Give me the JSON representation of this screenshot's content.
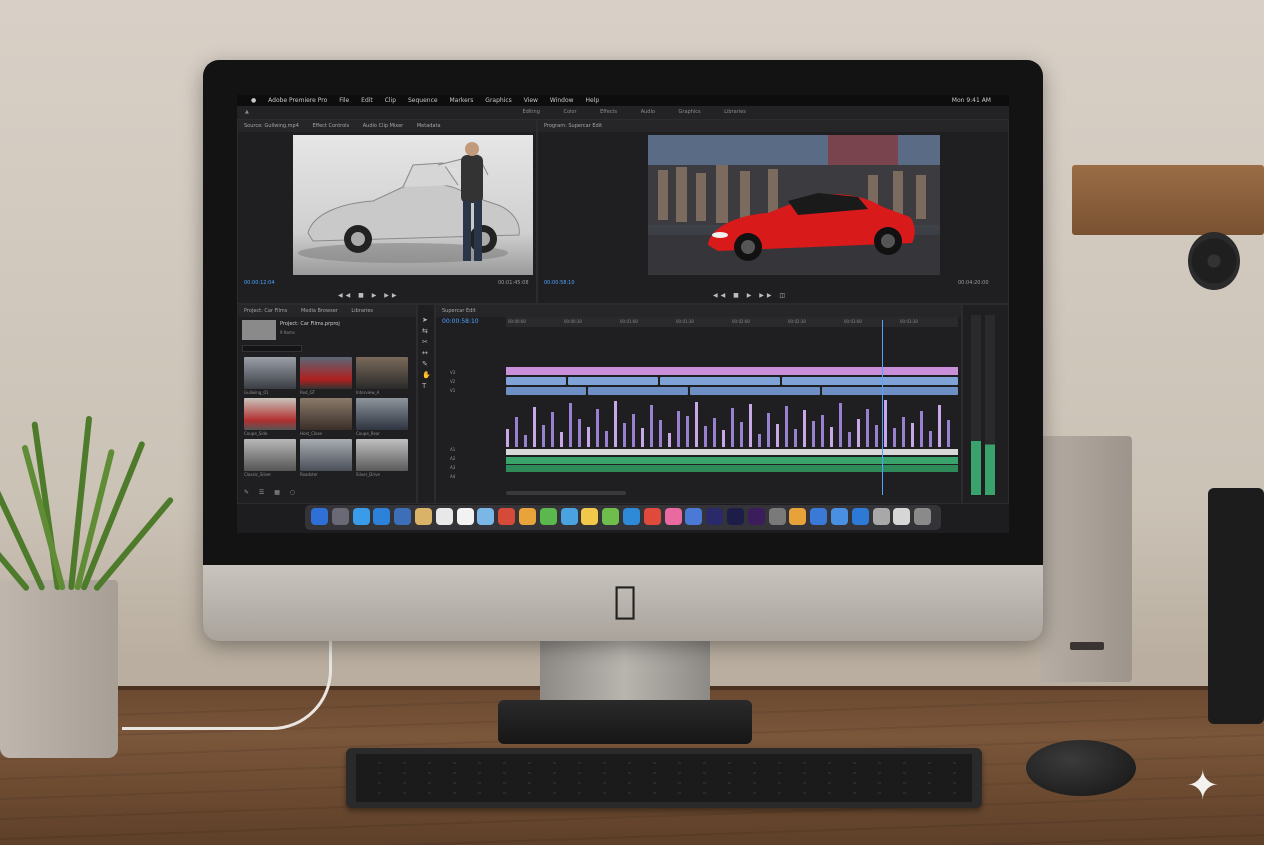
{
  "scene": {
    "description_hidden": "",
    "screen": {
      "menubar": {
        "app_name": "Adobe Premiere Pro",
        "items": [
          "File",
          "Edit",
          "Clip",
          "Sequence",
          "Markers",
          "Graphics",
          "View",
          "Window",
          "Help"
        ],
        "clock": "Mon 9:41 AM"
      },
      "workspaces": [
        "Editing",
        "Color",
        "Effects",
        "Audio",
        "Graphics",
        "Libraries"
      ],
      "source_panel": {
        "tabs": [
          "Source: Gullwing.mp4",
          "Effect Controls",
          "Audio Clip Mixer",
          "Metadata"
        ],
        "timecode_left": "00:00:12:04",
        "timecode_right": "00:01:45:08"
      },
      "program_panel": {
        "tab": "Program: Supercar Edit",
        "timecode_left": "00:00:58:10",
        "timecode_right": "00:04:20:00"
      },
      "project_panel": {
        "tabs": [
          "Project: Car Films",
          "Media Browser",
          "Libraries"
        ],
        "project_title": "Project: Car Films.prproj",
        "item_count": "9 Items",
        "thumbs": [
          "Gullwing_01",
          "Red_GT",
          "Interview_A",
          "Coupe_Side",
          "Host_Close",
          "Coupe_Rear",
          "Classic_Silver",
          "Roadster",
          "Silver_Drive"
        ]
      },
      "timeline_panel": {
        "tab": "Supercar Edit",
        "timecode": "00:00:58:10",
        "ruler": [
          "00:00:00",
          "00:00:30",
          "00:01:00",
          "00:01:30",
          "00:02:00",
          "00:02:30",
          "00:03:00",
          "00:03:30"
        ],
        "track_labels": [
          "V3",
          "V2",
          "V1",
          "A1",
          "A2",
          "A3",
          "A4"
        ]
      },
      "dock_icon_colors": [
        "#2f6fd6",
        "#6a6a76",
        "#3a9be8",
        "#2d81d8",
        "#3c6fb8",
        "#d9b368",
        "#e8e8e8",
        "#f2f2f2",
        "#7ab7e6",
        "#d64a3a",
        "#e8a33a",
        "#5ab84e",
        "#4aa3e0",
        "#f1c84a",
        "#6fbd4a",
        "#2e8ad6",
        "#e04a3c",
        "#e86aa0",
        "#4a7ad6",
        "#2a2a6a",
        "#1d1d4a",
        "#3a1d5a",
        "#7a7a7a",
        "#e8a23a",
        "#3a7ad6",
        "#4a90e2",
        "#2d7ad6",
        "#a8a8a8",
        "#d6d6d6",
        "#8a8a8a"
      ]
    },
    "colors": {
      "accent": "#4ea4ff",
      "video_clip": "#7fa3d8",
      "title_clip": "#c98fd8",
      "audio_clip": "#3aa36b",
      "red_car": "#d81a1a",
      "silver_car": "#c9c9c9"
    }
  }
}
